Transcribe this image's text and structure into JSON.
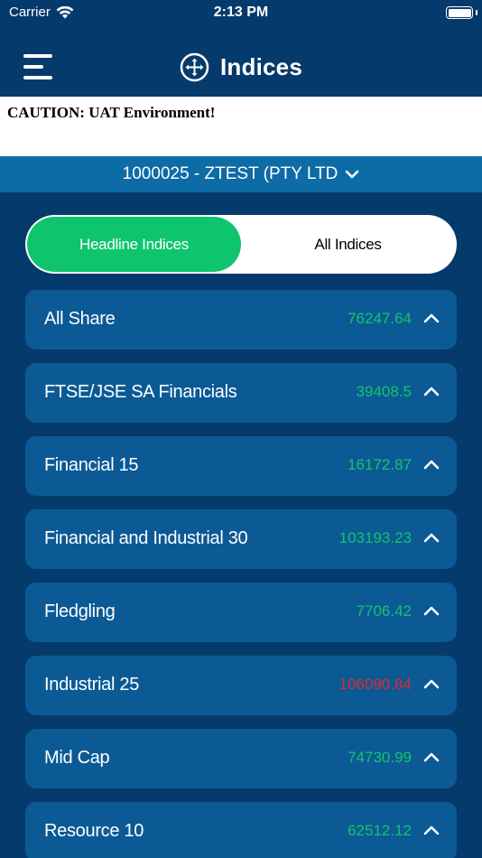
{
  "status_bar": {
    "carrier": "Carrier",
    "time": "2:13 PM"
  },
  "nav": {
    "title": "Indices",
    "title_icon": "move-arrows-icon",
    "menu_icon": "hamburger-menu-icon"
  },
  "caution": {
    "text": "CAUTION: UAT Environment!"
  },
  "account": {
    "label": "1000025 - ZTEST (PTY LTD",
    "icon": "chevron-down-icon"
  },
  "segments": {
    "headline": "Headline Indices",
    "all": "All Indices",
    "selected": "headline"
  },
  "colors": {
    "background": "#053a6c",
    "card": "#0b5a95",
    "account_bar": "#0d6ba6",
    "positive": "#13c46a",
    "negative": "#e02a2f",
    "segment_active": "#0ec56d"
  },
  "indices": [
    {
      "name": "All Share",
      "value": "76247.64",
      "trend": "positive"
    },
    {
      "name": "FTSE/JSE SA Financials",
      "value": "39408.5",
      "trend": "positive"
    },
    {
      "name": "Financial 15",
      "value": "16172.87",
      "trend": "positive"
    },
    {
      "name": "Financial and Industrial 30",
      "value": "103193.23",
      "trend": "positive"
    },
    {
      "name": "Fledgling",
      "value": "7706.42",
      "trend": "positive"
    },
    {
      "name": "Industrial 25",
      "value": "106090.84",
      "trend": "negative"
    },
    {
      "name": "Mid Cap",
      "value": "74730.99",
      "trend": "positive"
    },
    {
      "name": "Resource 10",
      "value": "62512.12",
      "trend": "positive"
    }
  ]
}
